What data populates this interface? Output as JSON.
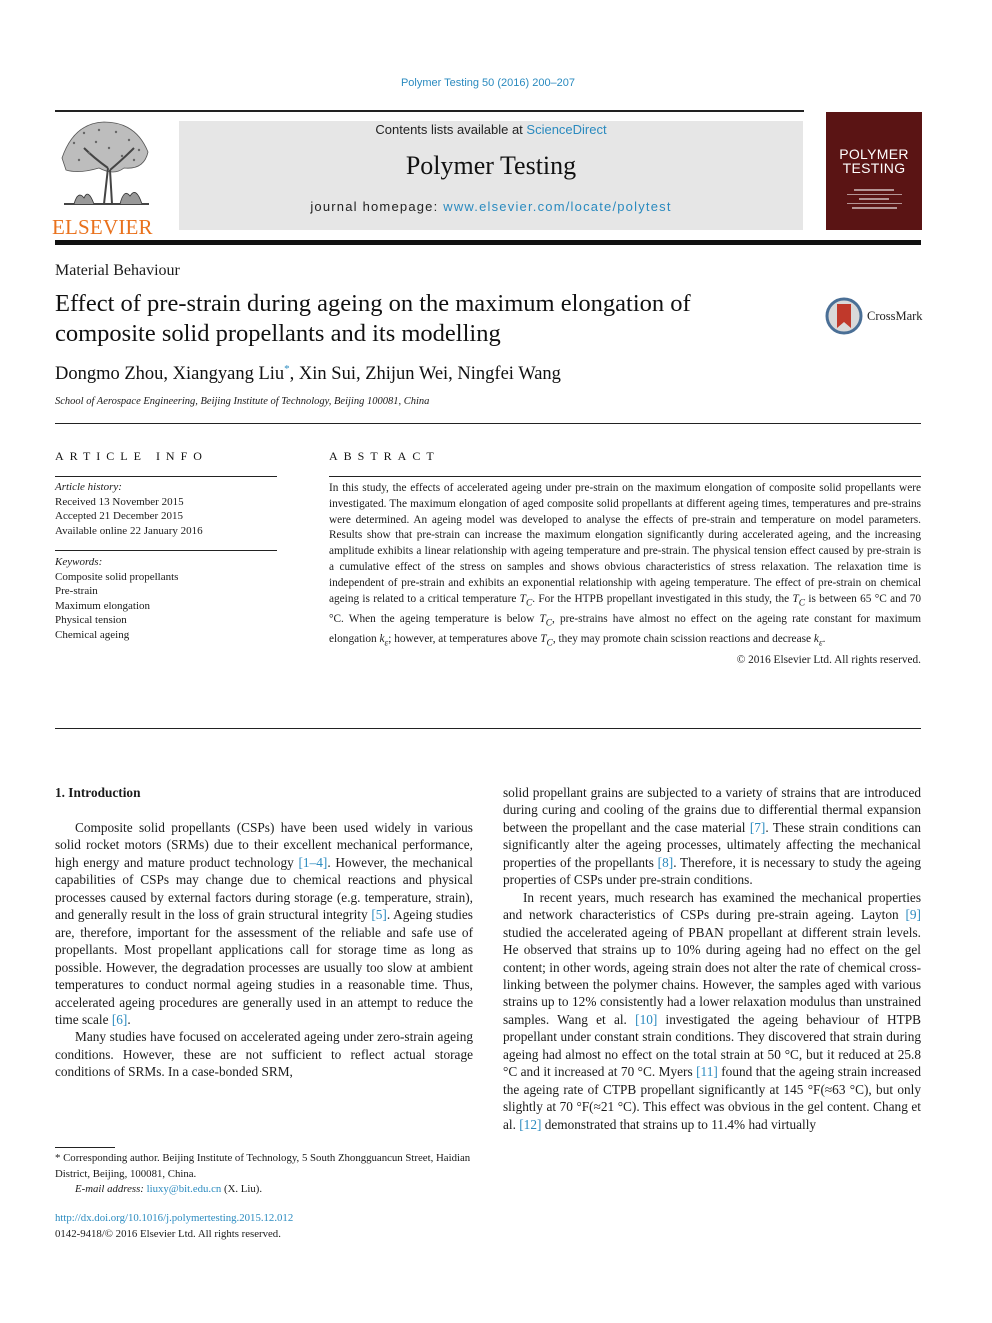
{
  "header": {
    "citation": "Polymer Testing 50 (2016) 200–207",
    "contents_prefix": "Contents lists available at ",
    "contents_link": "ScienceDirect",
    "journal_name": "Polymer Testing",
    "homepage_prefix": "journal homepage: ",
    "homepage_link": "www.elsevier.com/locate/polytest",
    "publisher_logo_text": "ELSEVIER",
    "cover_title_line1": "POLYMER",
    "cover_title_line2": "TESTING",
    "crossmark_label": "CrossMark"
  },
  "article": {
    "section_type": "Material Behaviour",
    "title": "Effect of pre-strain during ageing on the maximum elongation of composite solid propellants and its modelling",
    "authors_before": "Dongmo Zhou, Xiangyang Liu",
    "author_mark": "*",
    "authors_after": ", Xin Sui, Zhijun Wei, Ningfei Wang",
    "affiliation": "School of Aerospace Engineering, Beijing Institute of Technology, Beijing 100081, China"
  },
  "article_info": {
    "heading": "ARTICLE INFO",
    "history_label": "Article history:",
    "history": [
      "Received 13 November 2015",
      "Accepted 21 December 2015",
      "Available online 22 January 2016"
    ],
    "keywords_label": "Keywords:",
    "keywords": [
      "Composite solid propellants",
      "Pre-strain",
      "Maximum elongation",
      "Physical tension",
      "Chemical ageing"
    ]
  },
  "abstract": {
    "heading": "ABSTRACT",
    "p1": "In this study, the effects of accelerated ageing under pre-strain on the maximum elongation of composite solid propellants were investigated. The maximum elongation of aged composite solid propellants at different ageing times, temperatures and pre-strains were determined. An ageing model was developed to analyse the effects of pre-strain and temperature on model parameters. Results show that pre-strain can increase the maximum elongation significantly during accelerated ageing, and the increasing amplitude exhibits a linear relationship with ageing temperature and pre-strain. The physical tension effect caused by pre-strain is a cumulative effect of the stress on samples and shows obvious charac­teristics of stress relaxation. The relaxation time is independent of pre-strain and exhibits an exponential relationship with ageing temperature. The effect of pre-strain on chemical ageing is related to a critical temperature ",
    "tc": "T",
    "tc_sub": "C",
    "p2": ". For the HTPB propellant investigated in this study, the ",
    "p3": " is between 65 °C and 70 °C. When the ageing temperature is below ",
    "p4": ", pre-strains have almost no effect on the ageing rate constant for maximum elongation ",
    "k": "k",
    "k_sub": "ε",
    "p5": "; however, at temperatures above ",
    "p6": ", they may promote chain scission re­actions and decrease ",
    "p7": ".",
    "copyright": "© 2016 Elsevier Ltd. All rights reserved."
  },
  "body": {
    "intro_heading": "1.  Introduction",
    "left_p1_a": "Composite solid propellants (CSPs) have been used widely in various solid rocket motors (SRMs) due to their excellent me­chanical performance, high energy and mature product technology ",
    "ref_1_4": "[1–4]",
    "left_p1_b": ". However, the mechanical capabilities of CSPs may change due to chemical reactions and physical processes caused by external factors during storage (e.g. temperature, strain), and generally result in the loss of grain structural integrity ",
    "ref_5": "[5]",
    "left_p1_c": ". Ageing studies are, therefore, important for the assessment of the reliable and safe use of propellants. Most propellant applications call for storage time as long as possible. However, the degradation pro­cesses are usually too slow at ambient temperatures to conduct normal ageing studies in a reasonable time. Thus, accelerated ageing procedures are generally used in an attempt to reduce the time scale ",
    "ref_6": "[6]",
    "left_p1_d": ".",
    "left_p2": "Many studies have focused on accelerated ageing under zero-strain ageing conditions. However, these are not sufficient to reflect actual storage conditions of SRMs. In a case-bonded SRM,",
    "right_p1_a": "solid propellant grains are subjected to a variety of strains that are introduced during curing and cooling of the grains due to differ­ential thermal expansion between the propellant and the case material ",
    "ref_7": "[7]",
    "right_p1_b": ". These strain conditions can significantly alter the ageing processes, ultimately affecting the mechanical properties of the propellants ",
    "ref_8": "[8]",
    "right_p1_c": ". Therefore, it is necessary to study the ageing properties of CSPs under pre-strain conditions.",
    "right_p2_a": "In recent years, much research has examined the mechanical properties and network characteristics of CSPs during pre-strain ageing. Layton ",
    "ref_9": "[9]",
    "right_p2_b": " studied the accelerated ageing of PBAN propel­lant at different strain levels. He observed that strains up to 10% during ageing had no effect on the gel content; in other words, ageing strain does not alter the rate of chemical cross-linking be­tween the polymer chains. However, the samples aged with various strains up to 12% consistently had a lower relaxation modulus than unstrained samples. Wang et al. ",
    "ref_10": "[10]",
    "right_p2_c": " investigated the ageing behaviour of HTPB propellant under constant strain conditions. They discovered that strain during ageing had almost no effect on the total strain at 50 °C, but it reduced at 25.8 °C and it increased at 70 °C. Myers ",
    "ref_11": "[11]",
    "right_p2_d": " found that the ageing strain increased the ageing rate of CTPB propellant significantly at 145 °F(≈63 °C), but only slightly at 70 °F(≈21 °C). This effect was obvious in the gel content. Chang et al. ",
    "ref_12": "[12]",
    "right_p2_e": " demonstrated that strains up to 11.4% had virtually"
  },
  "footnotes": {
    "corresponding": "* Corresponding author. Beijing Institute of Technology, 5 South Zhongguancun Street, Haidian District, Beijing, 100081, China.",
    "email_label": "E-mail address: ",
    "email": "liuxy@bit.edu.cn",
    "email_suffix": " (X. Liu).",
    "doi": "http://dx.doi.org/10.1016/j.polymertesting.2015.12.012",
    "issn": "0142-9418/© 2016 Elsevier Ltd. All rights reserved."
  },
  "colors": {
    "link": "#2a8abf",
    "elsevier_orange": "#e9711c",
    "cover_maroon": "#5a1414",
    "banner_gray": "#e6e6e6"
  }
}
